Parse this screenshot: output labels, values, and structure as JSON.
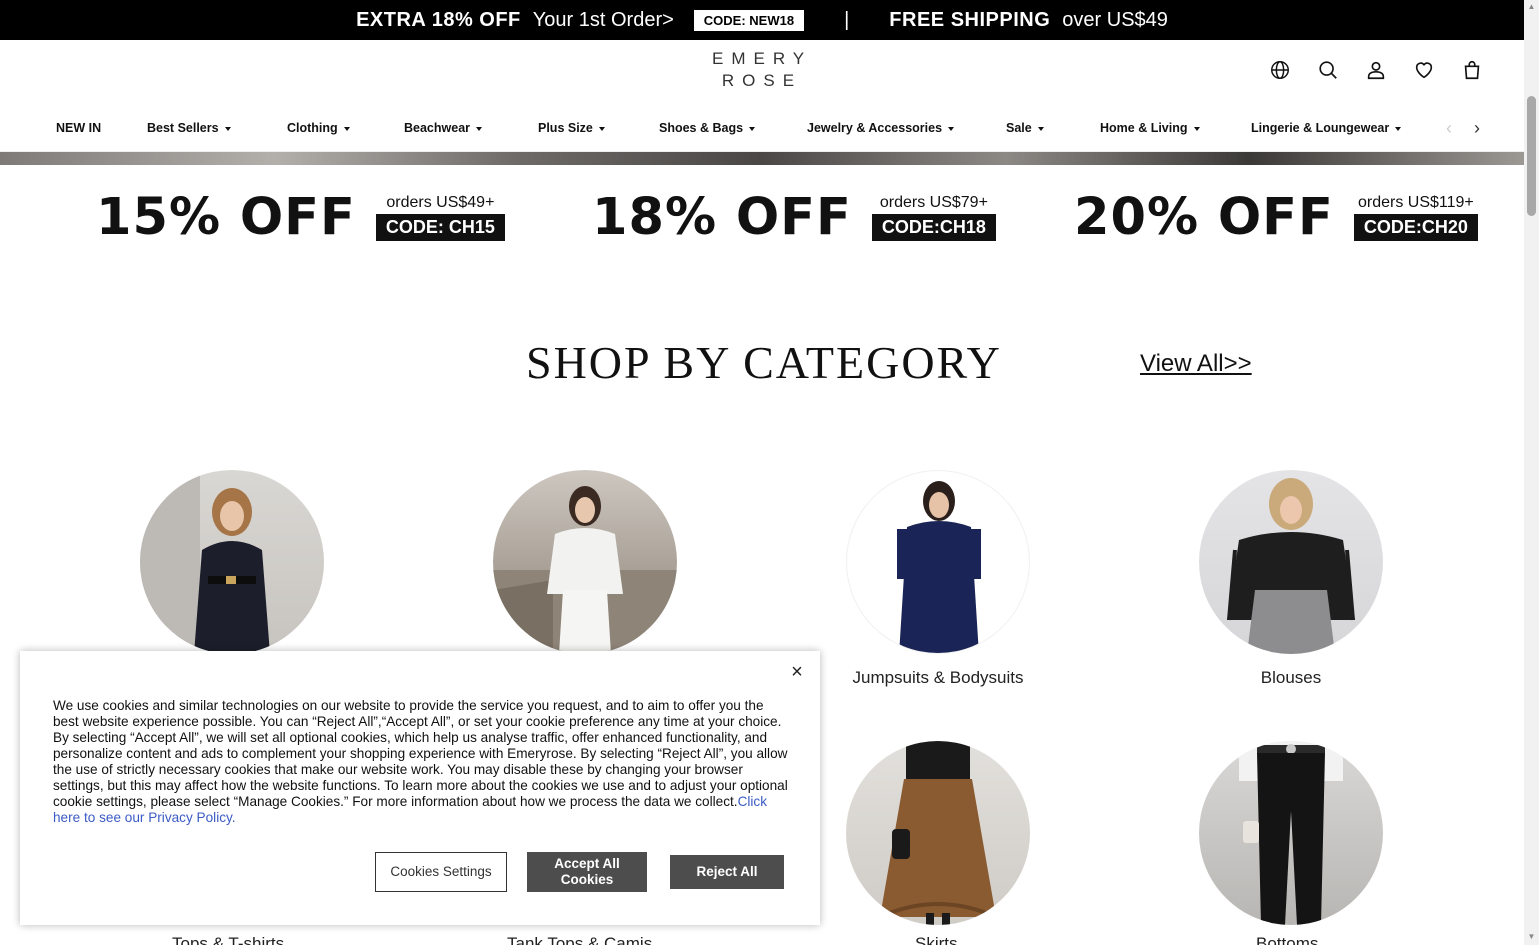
{
  "promo": {
    "extra": "EXTRA 18% OFF",
    "first_order": "Your 1st Order>",
    "code": "CODE: NEW18",
    "separator": "|",
    "shipping": "FREE SHIPPING",
    "shipping_threshold": "over US$49"
  },
  "header": {
    "logo_line1": "EMERY",
    "logo_line2": "ROSE",
    "icons": [
      "globe-icon",
      "search-icon",
      "user-icon",
      "heart-icon",
      "bag-icon"
    ]
  },
  "nav": {
    "items": [
      {
        "label": "NEW IN",
        "has_caret": false
      },
      {
        "label": "Best Sellers",
        "has_caret": true
      },
      {
        "label": "Clothing",
        "has_caret": true
      },
      {
        "label": "Beachwear",
        "has_caret": true
      },
      {
        "label": "Plus Size",
        "has_caret": true
      },
      {
        "label": "Shoes & Bags",
        "has_caret": true
      },
      {
        "label": "Jewelry & Accessories",
        "has_caret": true
      },
      {
        "label": "Sale",
        "has_caret": true
      },
      {
        "label": "Home & Living",
        "has_caret": true
      },
      {
        "label": "Lingerie & Loungewear",
        "has_caret": true
      }
    ],
    "prev": "‹",
    "next": "›"
  },
  "coupons": [
    {
      "percent": "15% OFF",
      "orders": "orders US$49+",
      "code": "CODE: CH15"
    },
    {
      "percent": "18% OFF",
      "orders": "orders US$79+",
      "code": "CODE:CH18"
    },
    {
      "percent": "20% OFF",
      "orders": "orders US$119+",
      "code": "CODE:CH20"
    }
  ],
  "section": {
    "title": "SHOP BY CATEGORY",
    "view_all": "View All>>"
  },
  "categories": [
    {
      "name": "",
      "image": "woman-black-dress"
    },
    {
      "name": "",
      "image": "woman-white-outfit"
    },
    {
      "name": "Jumpsuits & Bodysuits",
      "image": "woman-navy-dress"
    },
    {
      "name": "Blouses",
      "image": "woman-black-lace-blouse"
    },
    {
      "name": "",
      "image": "woman-brown-skirt"
    },
    {
      "name": "",
      "image": "woman-black-pants"
    }
  ],
  "partial_labels": [
    "Tops & T-shirts",
    "Tank Tops & Camis",
    "Skirts",
    "Bottoms"
  ],
  "cookie": {
    "text": "We use cookies and similar technologies on our website to provide the service you request, and to aim to offer you the best website experience possible. You can “Reject All”,“Accept All”, or set your cookie preference any time at your choice. By selecting “Accept All”, we will set all optional cookies, which help us analyse traffic, offer enhanced functionality, and personalize content and ads to complement your shopping experience with Emeryrose. By selecting “Reject All”, you allow the use of strictly necessary cookies that make our website work. You may disable these by changing your browser settings, but this may affect how the website functions. To learn more about the cookies we use and to adjust your optional cookie settings, please select “Manage Cookies.” For more information about how we process the data we collect.",
    "link": "Click here to see our Privacy Policy.",
    "settings_button": "Cookies Settings",
    "accept_button": "Accept All Cookies",
    "reject_button": "Reject All",
    "close": "×"
  }
}
